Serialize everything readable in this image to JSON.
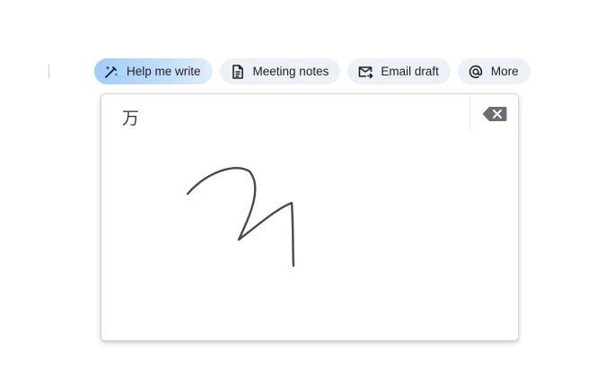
{
  "toolbar": {
    "chips": [
      {
        "label": "Help me write",
        "icon": "pen-sparkle-icon"
      },
      {
        "label": "Meeting notes",
        "icon": "document-icon"
      },
      {
        "label": "Email draft",
        "icon": "email-send-icon"
      },
      {
        "label": "More",
        "icon": "at-sign-icon"
      }
    ]
  },
  "handwriting": {
    "candidate": "万",
    "backspace_icon": "backspace-icon"
  },
  "colors": {
    "chip_background": "#edf1f7",
    "primary_chip_gradient_start": "#9fcdfb",
    "ink": "#4a4a4a",
    "icon_gray": "#5f6368"
  }
}
